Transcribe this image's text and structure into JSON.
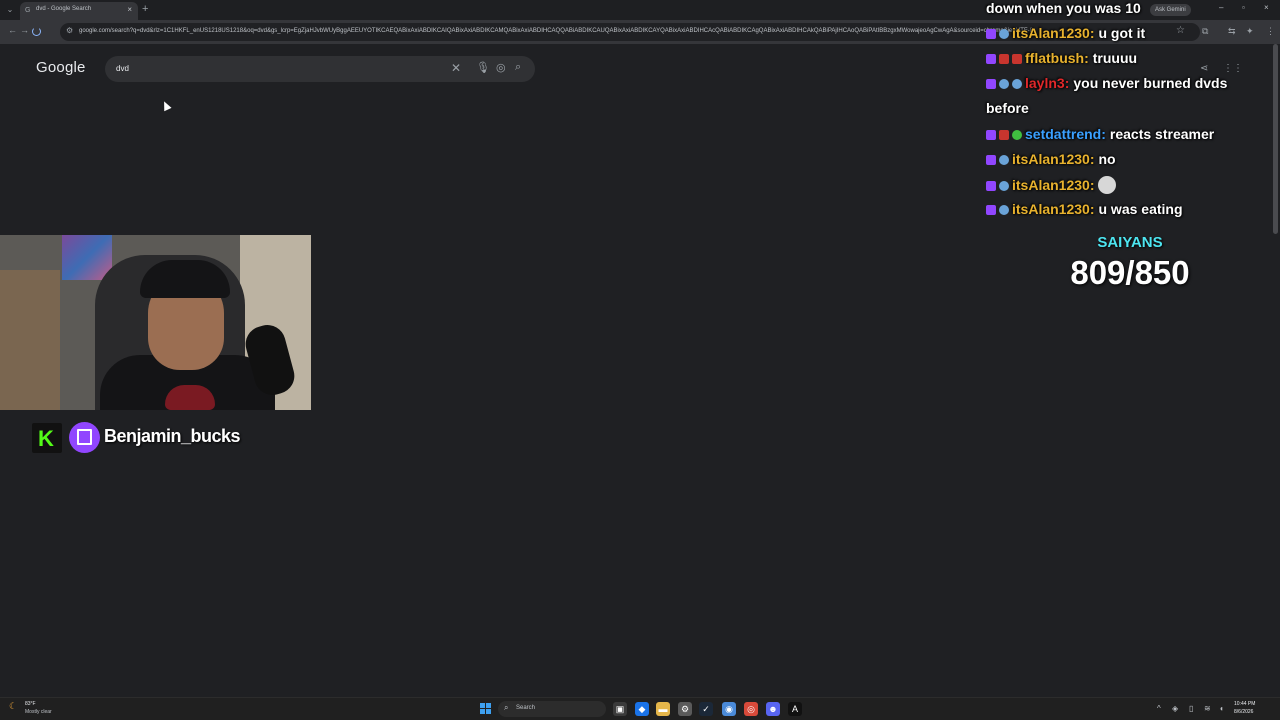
{
  "browser": {
    "tab_title": "dvd - Google Search",
    "tab_close": "×",
    "new_tab": "+",
    "ask_gemini": "Ask Gemini",
    "window_controls": [
      "–",
      "▫",
      "×"
    ],
    "url": "google.com/search?q=dvd&rlz=1C1HKFL_enUS1218US1218&oq=dvd&gs_lcrp=EgZjaHJvbWUyBggAEEUYOTIKCAEQABixAxiABDIKCAIQABixAxiABDIKCAMQABixAxiABDIHCAQQABiABDIKCAUQABixAxiABDIKCAYQABixAxiABDIHCAcQABiABDIKCAgQABixAxiABDIHCAkQABiPAjIHCAoQABiPAtIBBzgxMWowajeoAgCwAgA&sourceid=chrome&ie=UTF-8",
    "nav_icons": [
      "back-icon",
      "forward-icon",
      "reload-icon"
    ]
  },
  "google": {
    "logo": "Google",
    "search_value": "dvd",
    "clear": "✕"
  },
  "streamer": {
    "kick_letter": "K",
    "name": "Benjamin_bucks"
  },
  "chat": [
    {
      "name": "",
      "name_color": "#ffffff",
      "message": "down when you was 10",
      "badges": []
    },
    {
      "name": "itsAlan1230:",
      "name_color": "#e8b22e",
      "message": "u got it",
      "badges": [
        "twitch",
        "sub"
      ]
    },
    {
      "name": "fflatbush:",
      "name_color": "#e8b22e",
      "message": "truuuu",
      "badges": [
        "twitch",
        "red",
        "red"
      ]
    },
    {
      "name": "layln3:",
      "name_color": "#e0282a",
      "message": "you never burned dvds",
      "badges": [
        "twitch",
        "sub",
        "sub"
      ]
    },
    {
      "name": "",
      "name_color": "#ffffff",
      "message": "before",
      "badges": []
    },
    {
      "name": "setdattrend:",
      "name_color": "#3aa0ff",
      "message": "reacts streamer",
      "badges": [
        "twitch",
        "red",
        "green"
      ]
    },
    {
      "name": "itsAlan1230:",
      "name_color": "#e8b22e",
      "message": "no",
      "badges": [
        "twitch",
        "sub"
      ]
    },
    {
      "name": "itsAlan1230:",
      "name_color": "#e8b22e",
      "message": "",
      "badges": [
        "twitch",
        "sub"
      ],
      "emote": true
    },
    {
      "name": "itsAlan1230:",
      "name_color": "#e8b22e",
      "message": "u was eating",
      "badges": [
        "twitch",
        "sub"
      ]
    }
  ],
  "goal": {
    "title": "SAIYANS",
    "count": "809/850"
  },
  "taskbar": {
    "weather_temp": "83°F",
    "weather_desc": "Mostly clear",
    "search_label": "Search",
    "time": "10:44 PM",
    "date": "8/6/2026"
  }
}
